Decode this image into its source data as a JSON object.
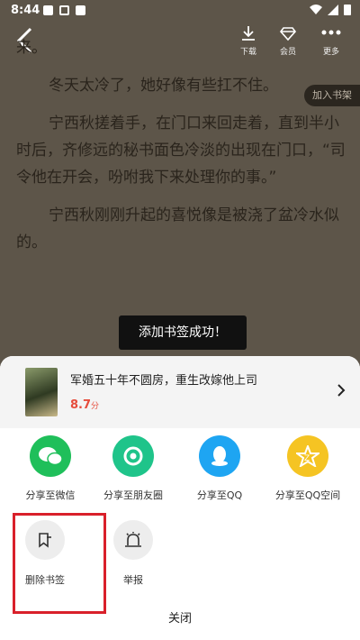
{
  "status_bar": {
    "time": "8:44"
  },
  "top_bar": {
    "download_label": "下载",
    "member_label": "会员",
    "more_label": "更多"
  },
  "reader": {
    "line_top": "来。",
    "para1": "冬天太冷了，她好像有些扛不住。",
    "para2": "宁西秋搓着手，在门口来回走着，直到半小时后，齐修远的秘书面色冷淡的出现在门口，“司令他在开会，吩咐我下来处理你的事。”",
    "para3": "宁西秋刚刚升起的喜悦像是被浇了盆冷水似的。",
    "add_to_shelf": "加入书架"
  },
  "toast": "添加书签成功！",
  "book": {
    "title": "军婚五十年不圆房，重生改嫁他上司",
    "score": "8.7",
    "score_unit": "分"
  },
  "share": [
    {
      "label": "分享至微信",
      "icon": "wechat-icon",
      "color": "#1fbf5a"
    },
    {
      "label": "分享至朋友圈",
      "icon": "moments-icon",
      "color": "#1fc48a"
    },
    {
      "label": "分享至QQ",
      "icon": "qq-icon",
      "color": "#1ea5f2"
    },
    {
      "label": "分享至QQ空间",
      "icon": "qzone-icon",
      "color": "#f5c423"
    }
  ],
  "actions": [
    {
      "label": "删除书签",
      "icon": "delete-bookmark-icon"
    },
    {
      "label": "举报",
      "icon": "report-icon"
    }
  ],
  "close_label": "关闭"
}
